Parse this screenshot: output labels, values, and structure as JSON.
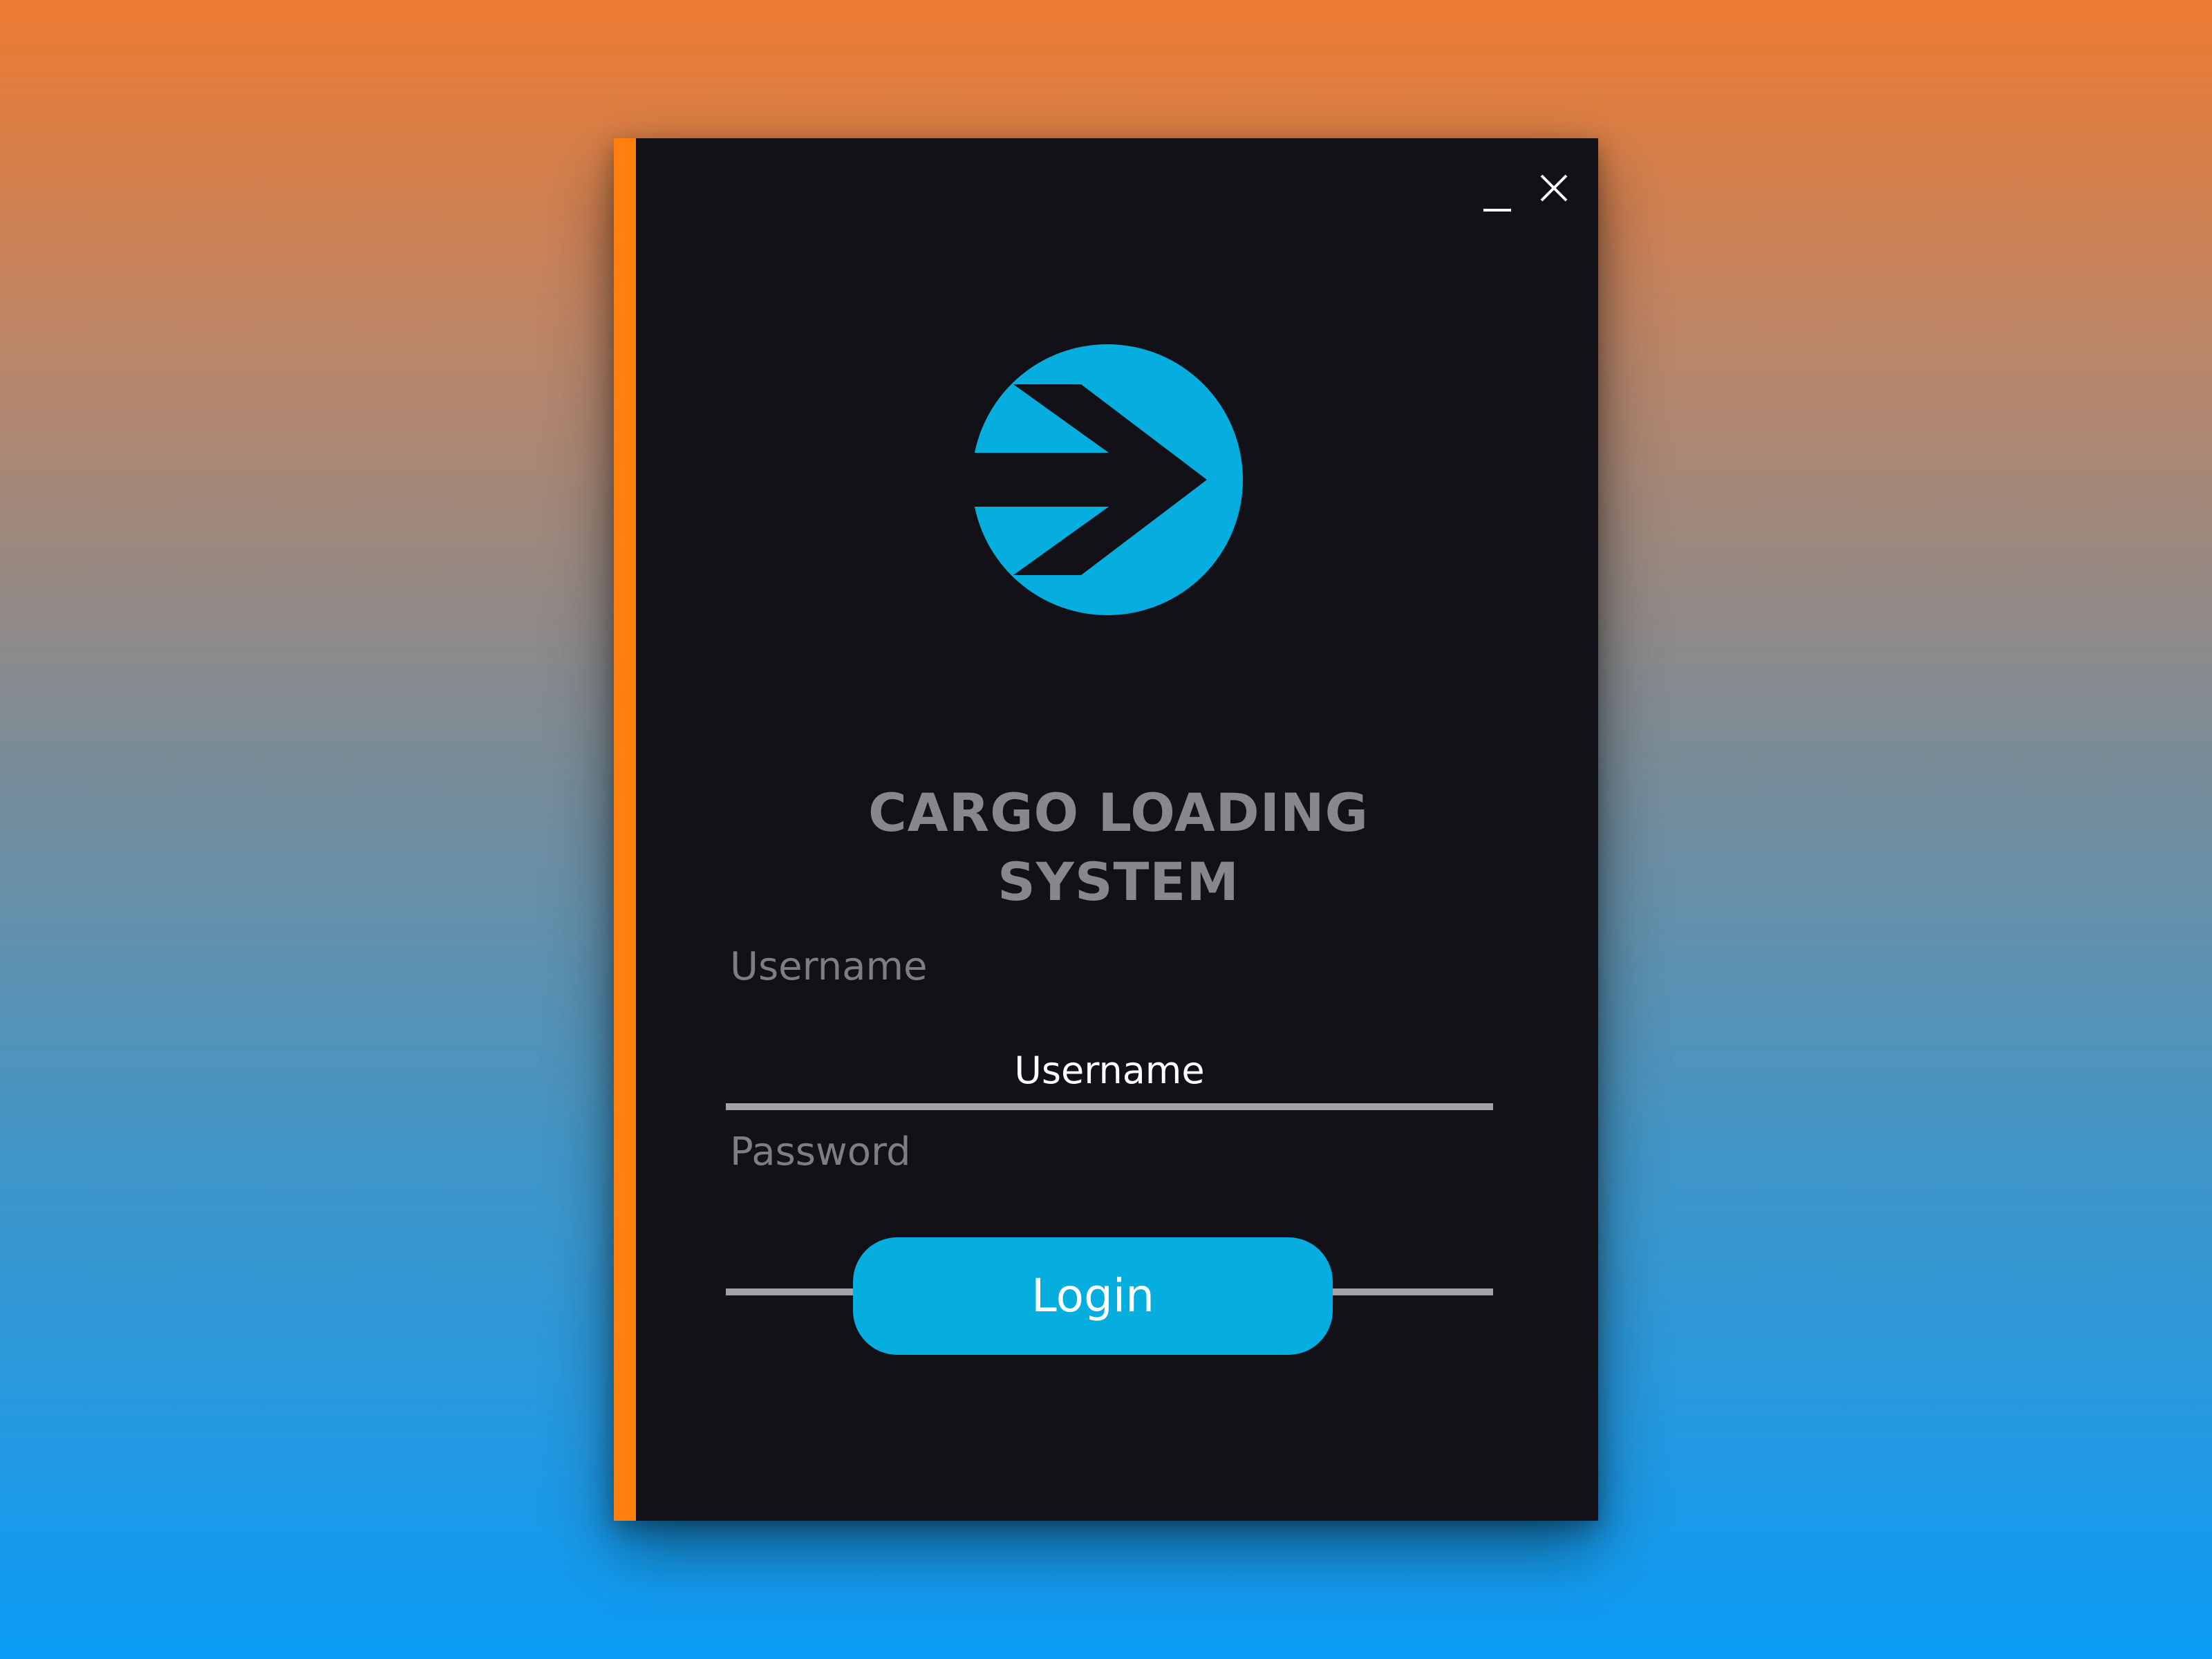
{
  "window": {
    "minimize_icon": "minimize-icon",
    "close_icon": "close-icon",
    "accent_color": "#ff7f0f",
    "background_color": "#111117"
  },
  "logo": {
    "icon": "arrow-circle-logo",
    "color": "#05aede"
  },
  "app": {
    "title_line1": "CARGO LOADING",
    "title_line2": "SYSTEM"
  },
  "form": {
    "username_label": "Username",
    "username_value": "Username",
    "password_label": "Password",
    "password_value": "********",
    "login_label": "Login"
  },
  "colors": {
    "button": "#05aede",
    "label_text": "#7d7d82",
    "title_text": "#88888c",
    "input_underline": "#a3a3a7"
  }
}
